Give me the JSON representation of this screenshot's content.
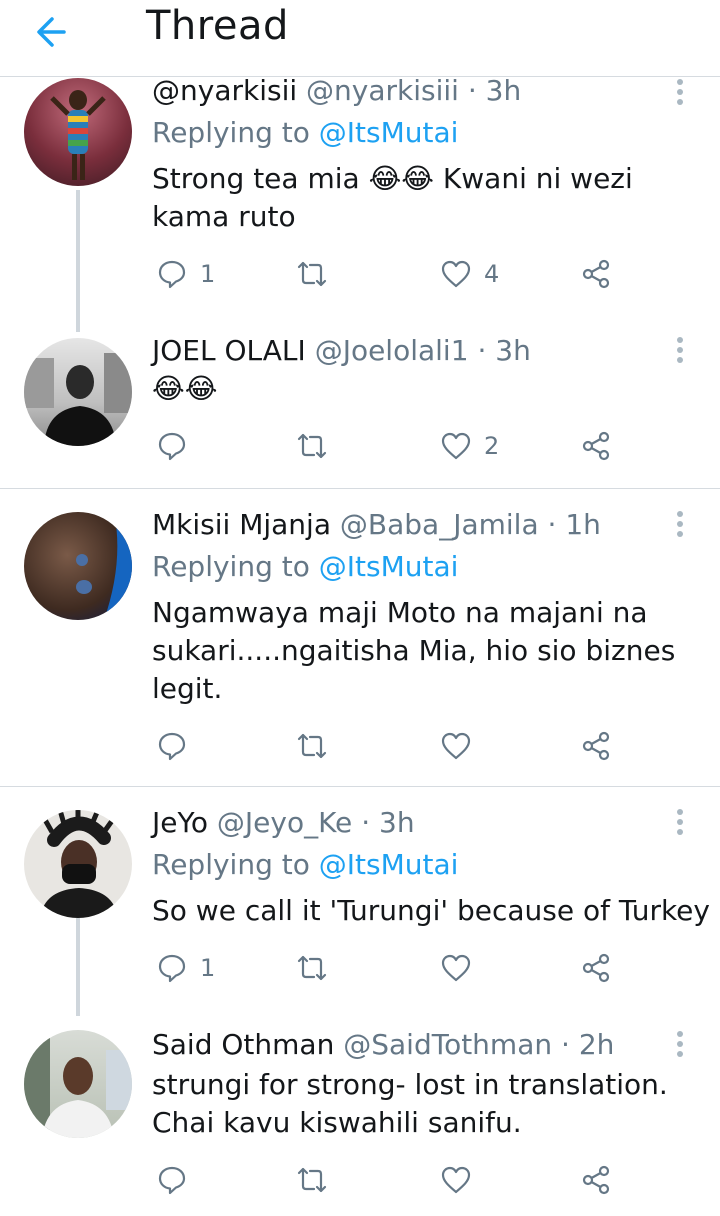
{
  "header": {
    "title": "Thread"
  },
  "tweets": [
    {
      "name": "@nyarkisii",
      "handle": "@nyarkisiii",
      "time": "3h",
      "replying_prefix": "Replying to ",
      "replying_handle": "@ItsMutai",
      "text": "Strong tea mia 😂😂 Kwani ni wezi\nkama ruto",
      "reply_count": "1",
      "retweet_count": "",
      "like_count": "4"
    },
    {
      "name": "JOEL OLALI",
      "handle": "@Joelolali1",
      "time": "3h",
      "text": "😂😂",
      "reply_count": "",
      "retweet_count": "",
      "like_count": "2"
    },
    {
      "name": "Mkisii Mjanja",
      "handle": "@Baba_Jamila",
      "time": "1h",
      "replying_prefix": "Replying to ",
      "replying_handle": "@ItsMutai",
      "text": "Ngamwaya maji Moto na majani na\nsukari.....ngaitisha Mia, hio sio biznes\nlegit.",
      "reply_count": "",
      "retweet_count": "",
      "like_count": ""
    },
    {
      "name": "JeYo",
      "handle": "@Jeyo_Ke",
      "time": "3h",
      "replying_prefix": "Replying to ",
      "replying_handle": "@ItsMutai",
      "text": "So we call it 'Turungi' because of Turkey",
      "reply_count": "1",
      "retweet_count": "",
      "like_count": ""
    },
    {
      "name": "Said Othman",
      "handle": "@SaidTothman",
      "time": "2h",
      "text": "strungi for strong-  lost in translation.\nChai kavu  kiswahili sanifu.",
      "reply_count": "",
      "retweet_count": "",
      "like_count": ""
    }
  ],
  "icons": {
    "back": "arrow-left-icon",
    "more": "more-vertical-icon",
    "reply": "reply-icon",
    "retweet": "retweet-icon",
    "like": "heart-icon",
    "share": "share-icon"
  },
  "colors": {
    "accent": "#1da1f2",
    "secondary_text": "#657786",
    "divider": "#d6dbe0"
  }
}
